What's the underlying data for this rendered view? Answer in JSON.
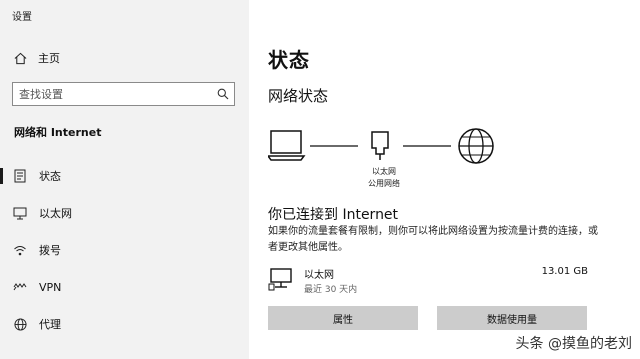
{
  "window": {
    "title": "设置"
  },
  "sidebar": {
    "home_label": "主页",
    "search_placeholder": "查找设置",
    "section_title": "网络和 Internet",
    "items": [
      {
        "label": "状态",
        "icon": "status-icon",
        "active": true
      },
      {
        "label": "以太网",
        "icon": "ethernet-icon"
      },
      {
        "label": "拨号",
        "icon": "dialup-icon"
      },
      {
        "label": "VPN",
        "icon": "vpn-icon"
      },
      {
        "label": "代理",
        "icon": "proxy-globe-icon"
      }
    ]
  },
  "main": {
    "heading": "状态",
    "subheading": "网络状态",
    "network_label_line1": "以太网",
    "network_label_line2": "公用网络",
    "connected_title": "你已连接到 Internet",
    "description": "如果你的流量套餐有限制，则你可以将此网络设置为按流量计费的连接，或者更改其他属性。",
    "connection": {
      "name": "以太网",
      "period": "最近 30 天内",
      "usage": "13.01 GB"
    },
    "buttons": {
      "properties": "属性",
      "data_usage": "数据使用量"
    }
  },
  "watermark": "头条 @摸鱼的老刘"
}
